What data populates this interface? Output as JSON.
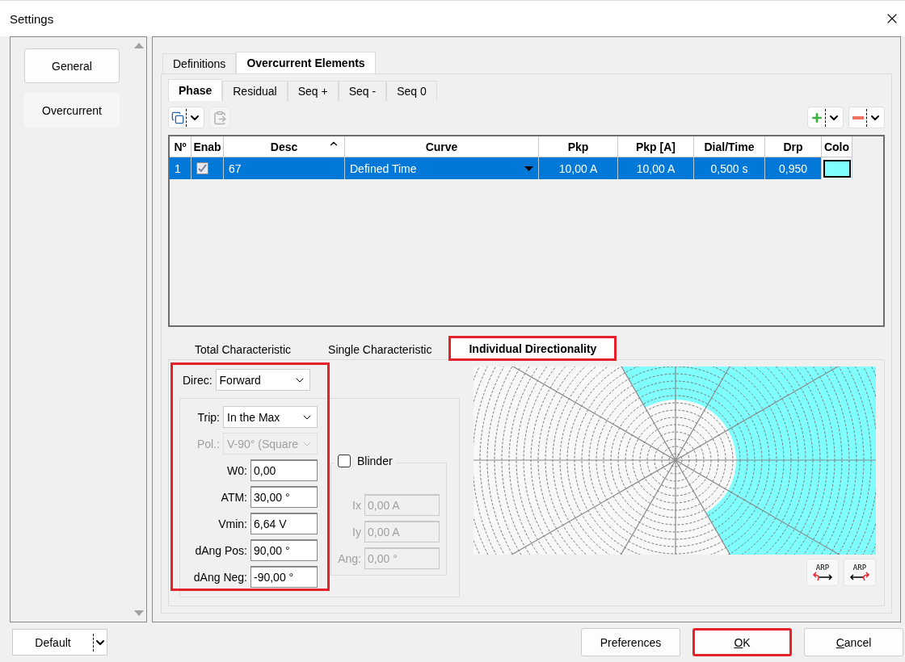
{
  "window": {
    "title": "Settings"
  },
  "sidebar": {
    "items": [
      {
        "label": "General",
        "selected": false
      },
      {
        "label": "Overcurrent",
        "selected": true
      }
    ]
  },
  "main_tabs": [
    {
      "label": "Definitions",
      "selected": false
    },
    {
      "label": "Overcurrent Elements",
      "selected": true
    }
  ],
  "element_tabs": [
    {
      "label": "Phase",
      "selected": true
    },
    {
      "label": "Residual",
      "selected": false
    },
    {
      "label": "Seq +",
      "selected": false
    },
    {
      "label": "Seq -",
      "selected": false
    },
    {
      "label": "Seq 0",
      "selected": false
    }
  ],
  "toolbar": {
    "paste_disabled": true
  },
  "table": {
    "columns": [
      {
        "label": "Nº",
        "sorted": false
      },
      {
        "label": "Enab",
        "sorted": false
      },
      {
        "label": "Desc",
        "sorted": true
      },
      {
        "label": "Curve",
        "sorted": false
      },
      {
        "label": "Pkp",
        "sorted": false
      },
      {
        "label": "Pkp [A]",
        "sorted": false
      },
      {
        "label": "Dial/Time",
        "sorted": false
      },
      {
        "label": "Drp",
        "sorted": false
      },
      {
        "label": "Colo",
        "sorted": false
      }
    ],
    "rows": [
      {
        "selected": true,
        "number": "1",
        "enabled": true,
        "desc": "67",
        "curve": "Defined Time",
        "pkp": "10,00 A",
        "pkp_a": "10,00 A",
        "dial_time": "0,500 s",
        "drp": "0,950",
        "color": "#80ffff"
      }
    ]
  },
  "chart_tabs": [
    {
      "label": "Total Characteristic",
      "selected": false,
      "highlighted": false
    },
    {
      "label": "Single Characteristic",
      "selected": false,
      "highlighted": false
    },
    {
      "label": "Individual Directionality",
      "selected": true,
      "highlighted": true
    }
  ],
  "directionality": {
    "highlighted": true,
    "direc": {
      "label": "Direc:",
      "value": "Forward"
    },
    "fields": [
      {
        "kind": "select",
        "label": "Trip:",
        "value": "In the Max",
        "disabled": false
      },
      {
        "kind": "select",
        "label": "Pol.:",
        "value": "V-90° (Square",
        "disabled": true
      },
      {
        "kind": "text",
        "label": "W0:",
        "value": "0,00",
        "disabled": false
      },
      {
        "kind": "text",
        "label": "ATM:",
        "value": "30,00 °",
        "disabled": false
      },
      {
        "kind": "text",
        "label": "Vmin:",
        "value": "6,64 V",
        "disabled": false
      },
      {
        "kind": "text",
        "label": "dAng Pos:",
        "value": "90,00 °",
        "disabled": false
      },
      {
        "kind": "text",
        "label": "dAng Neg:",
        "value": "-90,00 °",
        "disabled": false
      }
    ],
    "blinder": {
      "label": "Blinder",
      "checked": false,
      "fields": [
        {
          "label": "Ix",
          "value": "0,00 A",
          "disabled": true
        },
        {
          "label": "Iy",
          "value": "0,00 A",
          "disabled": true
        },
        {
          "label": "Ang:",
          "value": "0,00 °",
          "disabled": true
        }
      ]
    }
  },
  "chart_buttons": [
    {
      "text": "ARP",
      "kind": "rotate-left"
    },
    {
      "text": "ARP",
      "kind": "rotate-right"
    }
  ],
  "footer": {
    "default_button": "Default",
    "buttons": [
      {
        "label": "Preferences",
        "highlighted": false,
        "underline_first": false
      },
      {
        "label": "OK",
        "highlighted": true,
        "underline_first": true
      },
      {
        "label": "Cancel",
        "highlighted": false,
        "underline_first": true
      }
    ]
  }
}
